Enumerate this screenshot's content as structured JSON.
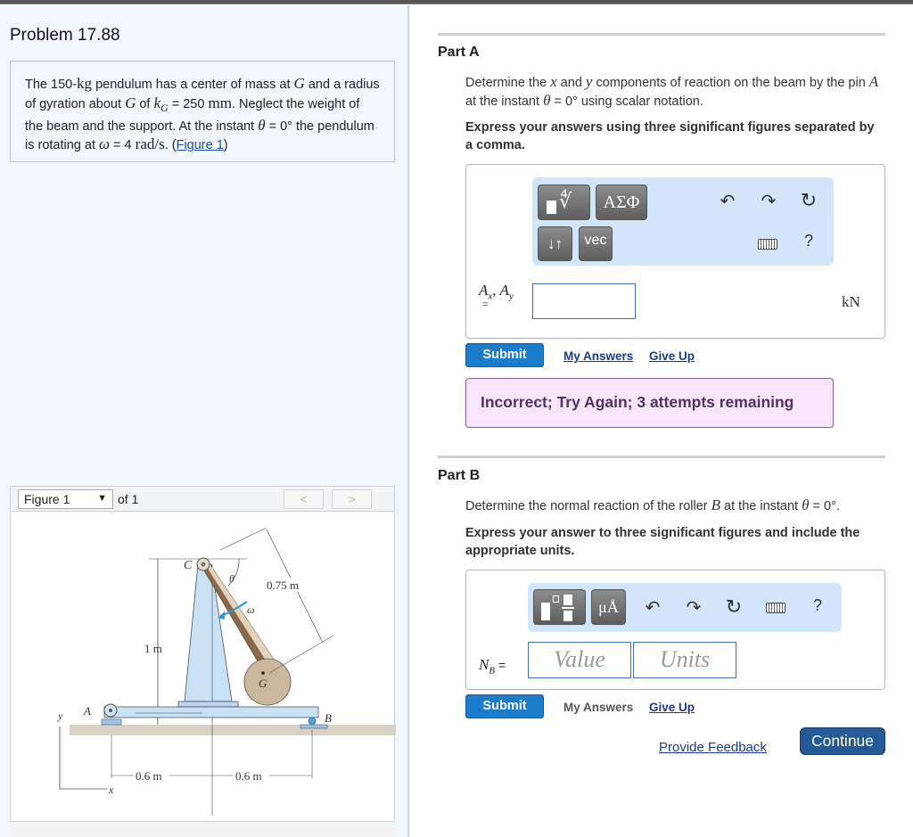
{
  "problem": {
    "title": "Problem 17.88",
    "statement": {
      "p1": "The 150-",
      "kg": "kg",
      "p2": " pendulum has a center of mass at ",
      "G1": "G",
      "p3": " and a radius of gyration about ",
      "G2": "G",
      "p4": " of ",
      "kG": "k",
      "kG_sub": "G",
      "p5": " = 250 ",
      "mm": "mm",
      "p6": ". Neglect the weight of the beam and the support. At the instant ",
      "theta": "θ",
      "p7": " = 0° the pendulum is rotating at ",
      "omega": "ω",
      "p8": " = 4 ",
      "rads": "rad/s",
      "p9": ". (",
      "figure_link": "Figure 1",
      "p10": ")"
    }
  },
  "figure": {
    "selected": "Figure 1",
    "of_label": "of 1",
    "prev_label": "<",
    "next_label": ">",
    "labels": {
      "C": "C",
      "theta": "θ",
      "omega": "ω",
      "len_075": "0.75 m",
      "len_1": "1 m",
      "G": "G",
      "A": "A",
      "B": "B",
      "y": "y",
      "x": "x",
      "len_06a": "0.6 m",
      "len_06b": "0.6 m"
    }
  },
  "partA": {
    "title": "Part A",
    "question": {
      "t1": "Determine the ",
      "x": "x",
      "t2": " and ",
      "y": "y",
      "t3": " components of reaction on the beam by the pin ",
      "A": "A",
      "t4": " at the instant ",
      "theta": "θ",
      "t5": " = 0° using scalar notation."
    },
    "instruction": "Express your answers using three significant figures separated by a comma.",
    "toolbar": {
      "template_icon": "template-radical-icon",
      "greek_label": "ΑΣΦ",
      "sort_label": "↓↑",
      "vec_label": "vec",
      "undo": "undo-icon",
      "redo": "redo-icon",
      "reset": "reset-icon",
      "keyboard": "keyboard-icon",
      "help_label": "?"
    },
    "answer_label": {
      "Ax": "A",
      "x_sub": "x",
      "sep": ", ",
      "Ay": "A",
      "y_sub": "y",
      "eq": "="
    },
    "answer_value": "",
    "unit": "kN",
    "submit_label": "Submit",
    "my_answers_label": "My Answers",
    "give_up_label": "Give Up",
    "feedback": "Incorrect; Try Again; 3 attempts remaining"
  },
  "partB": {
    "title": "Part B",
    "question": {
      "t1": "Determine the normal reaction of the roller ",
      "B": "B",
      "t2": " at the instant ",
      "theta": "θ",
      "t3": " = 0°."
    },
    "instruction": "Express your answer to three significant figures and include the appropriate units.",
    "toolbar": {
      "template_icon": "template-fraction-icon",
      "units_label": "μÅ",
      "undo": "undo-icon",
      "redo": "redo-icon",
      "reset": "reset-icon",
      "keyboard": "keyboard-icon",
      "help_label": "?"
    },
    "answer_label": {
      "N": "N",
      "sub": "B",
      "eq": " ="
    },
    "value_placeholder": "Value",
    "units_placeholder": "Units",
    "submit_label": "Submit",
    "my_answers_label": "My Answers",
    "give_up_label": "Give Up"
  },
  "footer": {
    "provide_feedback_label": "Provide Feedback",
    "continue_label": "Continue"
  }
}
